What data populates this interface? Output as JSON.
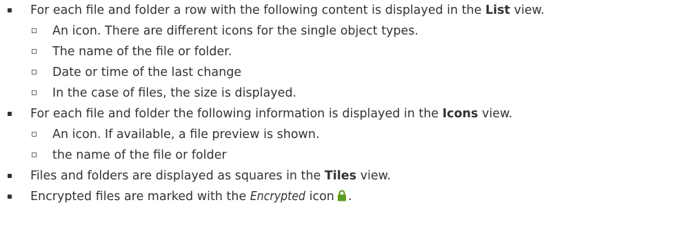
{
  "items": [
    {
      "text_before": "For each file and folder a row with the following content is displayed in the ",
      "bold": "List",
      "text_after": " view.",
      "subitems": [
        "An icon. There are different icons for the single object types.",
        "The name of the file or folder.",
        "Date or time of the last change",
        "In the case of files, the size is displayed."
      ]
    },
    {
      "text_before": "For each file and folder the following information is displayed in the ",
      "bold": "Icons",
      "text_after": " view.",
      "subitems": [
        "An icon. If available, a file preview is shown.",
        "the name of the file or folder"
      ]
    },
    {
      "text_before": "Files and folders are displayed as squares in the ",
      "bold": "Tiles",
      "text_after": " view."
    },
    {
      "text_before": "Encrypted files are marked with the ",
      "italic": "Encrypted",
      "text_mid": " icon",
      "icon": "lock-icon",
      "icon_color": "#5a9e1e",
      "text_after": "."
    }
  ]
}
